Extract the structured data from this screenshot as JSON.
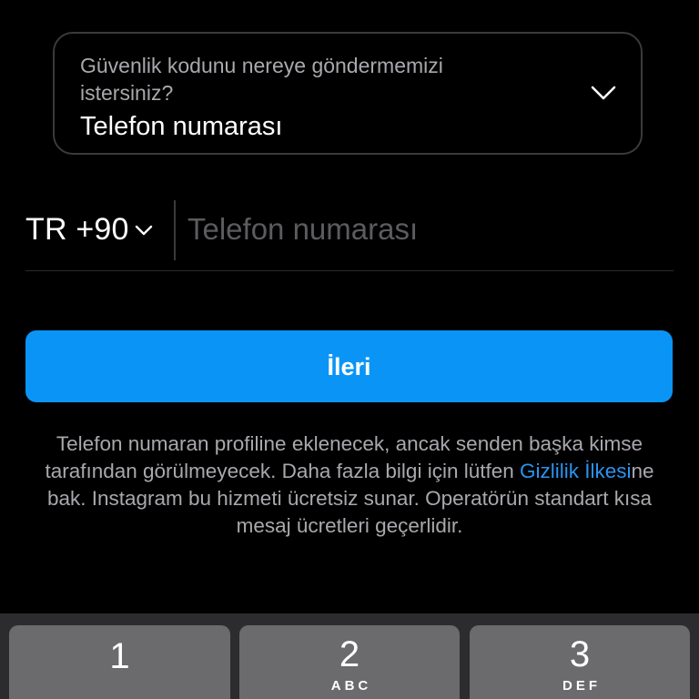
{
  "selector": {
    "question": "Güvenlik kodunu nereye göndermemizi istersiniz?",
    "value": "Telefon numarası",
    "icon": "chevron-down-icon"
  },
  "phone": {
    "country_code": "TR +90",
    "placeholder": "Telefon numarası",
    "value": ""
  },
  "next_button": {
    "label": "İleri",
    "color": "#0a95f6"
  },
  "info": {
    "text_before_link": "Telefon numaran profiline eklenecek, ancak senden başka kimse tarafından görülmeyecek. Daha fazla bilgi için lütfen ",
    "link_text": "Gizlilik İlkesi",
    "text_after_link": "ne bak. Instagram bu hizmeti ücretsiz sunar. Operatörün standart kısa mesaj ücretleri geçerlidir.",
    "link_color": "#2a93f0"
  },
  "keyboard": {
    "keys": [
      {
        "digit": "1",
        "letters": ""
      },
      {
        "digit": "2",
        "letters": "ABC"
      },
      {
        "digit": "3",
        "letters": "DEF"
      }
    ]
  }
}
